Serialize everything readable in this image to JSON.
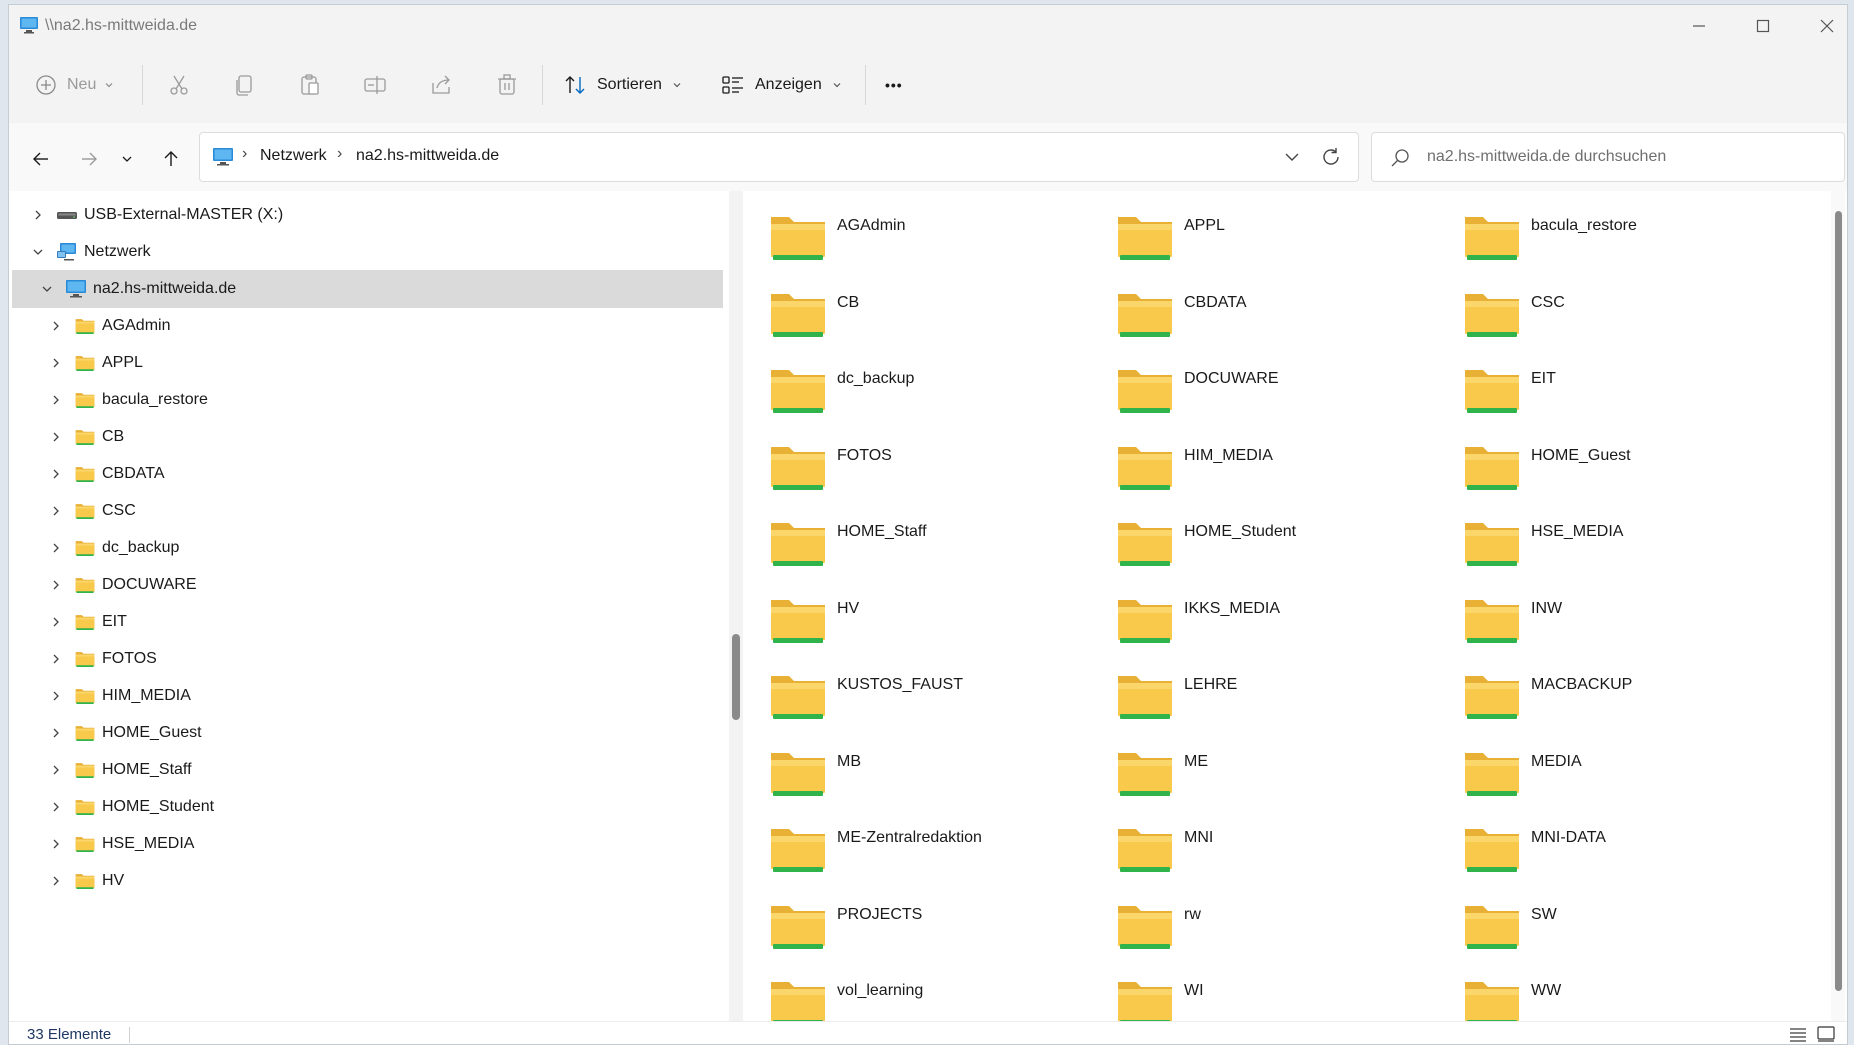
{
  "window": {
    "title": "\\\\na2.hs-mittweida.de"
  },
  "toolbar": {
    "new_label": "Neu",
    "sort_label": "Sortieren",
    "view_label": "Anzeigen",
    "more_label": "•••"
  },
  "address": {
    "crumbs": [
      "Netzwerk",
      "na2.hs-mittweida.de"
    ],
    "search_placeholder": "na2.hs-mittweida.de durchsuchen"
  },
  "tree": [
    {
      "label": "USB-External-MASTER (X:)",
      "level": 0,
      "icon": "drive-icon",
      "expanded": false
    },
    {
      "label": "Netzwerk",
      "level": 0,
      "icon": "network-icon",
      "expanded": true
    },
    {
      "label": "na2.hs-mittweida.de",
      "level": 1,
      "icon": "computer-icon",
      "expanded": true,
      "selected": true
    },
    {
      "label": "AGAdmin",
      "level": 2,
      "icon": "folder-icon"
    },
    {
      "label": "APPL",
      "level": 2,
      "icon": "folder-icon"
    },
    {
      "label": "bacula_restore",
      "level": 2,
      "icon": "folder-icon"
    },
    {
      "label": "CB",
      "level": 2,
      "icon": "folder-icon"
    },
    {
      "label": "CBDATA",
      "level": 2,
      "icon": "folder-icon"
    },
    {
      "label": "CSC",
      "level": 2,
      "icon": "folder-icon"
    },
    {
      "label": "dc_backup",
      "level": 2,
      "icon": "folder-icon"
    },
    {
      "label": "DOCUWARE",
      "level": 2,
      "icon": "folder-icon"
    },
    {
      "label": "EIT",
      "level": 2,
      "icon": "folder-icon"
    },
    {
      "label": "FOTOS",
      "level": 2,
      "icon": "folder-icon"
    },
    {
      "label": "HIM_MEDIA",
      "level": 2,
      "icon": "folder-icon"
    },
    {
      "label": "HOME_Guest",
      "level": 2,
      "icon": "folder-icon"
    },
    {
      "label": "HOME_Staff",
      "level": 2,
      "icon": "folder-icon"
    },
    {
      "label": "HOME_Student",
      "level": 2,
      "icon": "folder-icon"
    },
    {
      "label": "HSE_MEDIA",
      "level": 2,
      "icon": "folder-icon"
    },
    {
      "label": "HV",
      "level": 2,
      "icon": "folder-icon"
    }
  ],
  "shares": [
    "AGAdmin",
    "APPL",
    "bacula_restore",
    "CB",
    "CBDATA",
    "CSC",
    "dc_backup",
    "DOCUWARE",
    "EIT",
    "FOTOS",
    "HIM_MEDIA",
    "HOME_Guest",
    "HOME_Staff",
    "HOME_Student",
    "HSE_MEDIA",
    "HV",
    "IKKS_MEDIA",
    "INW",
    "KUSTOS_FAUST",
    "LEHRE",
    "MACBACKUP",
    "MB",
    "ME",
    "MEDIA",
    "ME-Zentralredaktion",
    "MNI",
    "MNI-DATA",
    "PROJECTS",
    "rw",
    "SW",
    "vol_learning",
    "WI",
    "WW"
  ],
  "status": {
    "count": "33 Elemente"
  },
  "colors": {
    "folder": "#f8c94a",
    "folder_band": "#2fb34a",
    "accent": "#0067c0"
  }
}
